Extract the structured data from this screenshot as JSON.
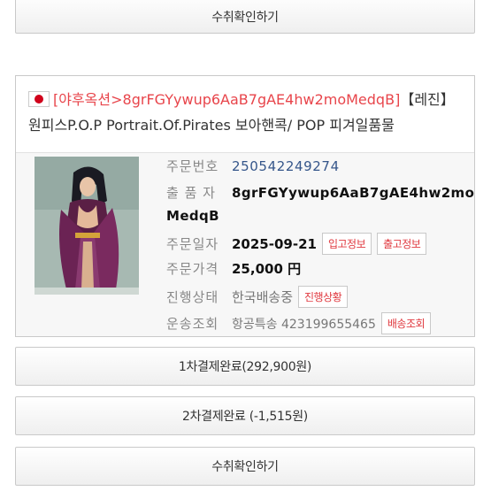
{
  "buttons": {
    "receipt_confirm_top": "수취확인하기",
    "payment1": "1차결제완료(292,900원)",
    "payment2": "2차결제완료 (-1,515원)",
    "receipt_confirm_bottom": "수취확인하기"
  },
  "order": {
    "title_prefix": "[야후옥션>8grFGYywup6AaB7gAE4hw2moMedqB]",
    "title_text": "【레진】원피스P.O.P Portrait.Of.Pirates 보아핸콕/ POP 피겨일품물",
    "flag_icon": "japan-flag-icon",
    "accent_color": "#e8454b",
    "labels": {
      "order_no": "주문번호",
      "seller": "출 품 자",
      "order_date": "주문일자",
      "price": "주문가격",
      "status": "진행상태",
      "tracking": "운송조회"
    },
    "order_no": "250542249274",
    "seller_line1": "8grFGYywup6AaB7gAE4hw2mo",
    "seller_line2": "MedqB",
    "order_date": "2025-09-21",
    "price": "25,000 円",
    "status": "한국배송중",
    "tracking": "항공특송 423199655465",
    "tag_receipt": "입고정보",
    "tag_shipment": "출고정보",
    "tag_progress": "진행상황",
    "tag_tracking": "배송조회"
  }
}
